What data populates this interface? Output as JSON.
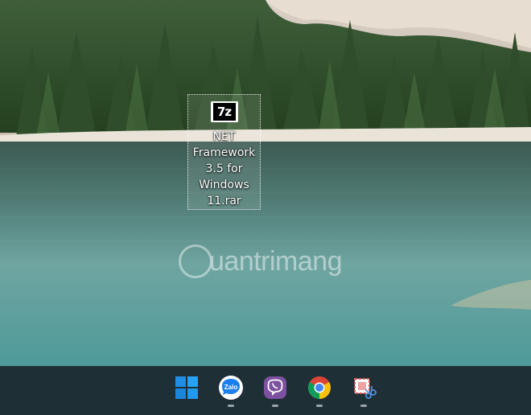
{
  "desktop": {
    "file_icon": {
      "badge": "7z",
      "label": "NET Framework 3.5 for Windows 11.rar"
    },
    "watermark": "uantrimang"
  },
  "taskbar": {
    "items": [
      {
        "name": "start",
        "icon": "windows-logo-icon",
        "running": false
      },
      {
        "name": "zalo",
        "icon": "zalo-icon",
        "label": "Zalo",
        "running": true
      },
      {
        "name": "viber",
        "icon": "viber-icon",
        "running": true
      },
      {
        "name": "chrome",
        "icon": "chrome-icon",
        "running": true
      },
      {
        "name": "snipping-tool",
        "icon": "snipping-tool-icon",
        "running": true
      }
    ]
  },
  "colors": {
    "taskbar": "#1f2f36",
    "windows_blue": "#1f8fe6",
    "zalo_blue": "#1c7ff0",
    "viber_purple": "#7d51a0"
  }
}
